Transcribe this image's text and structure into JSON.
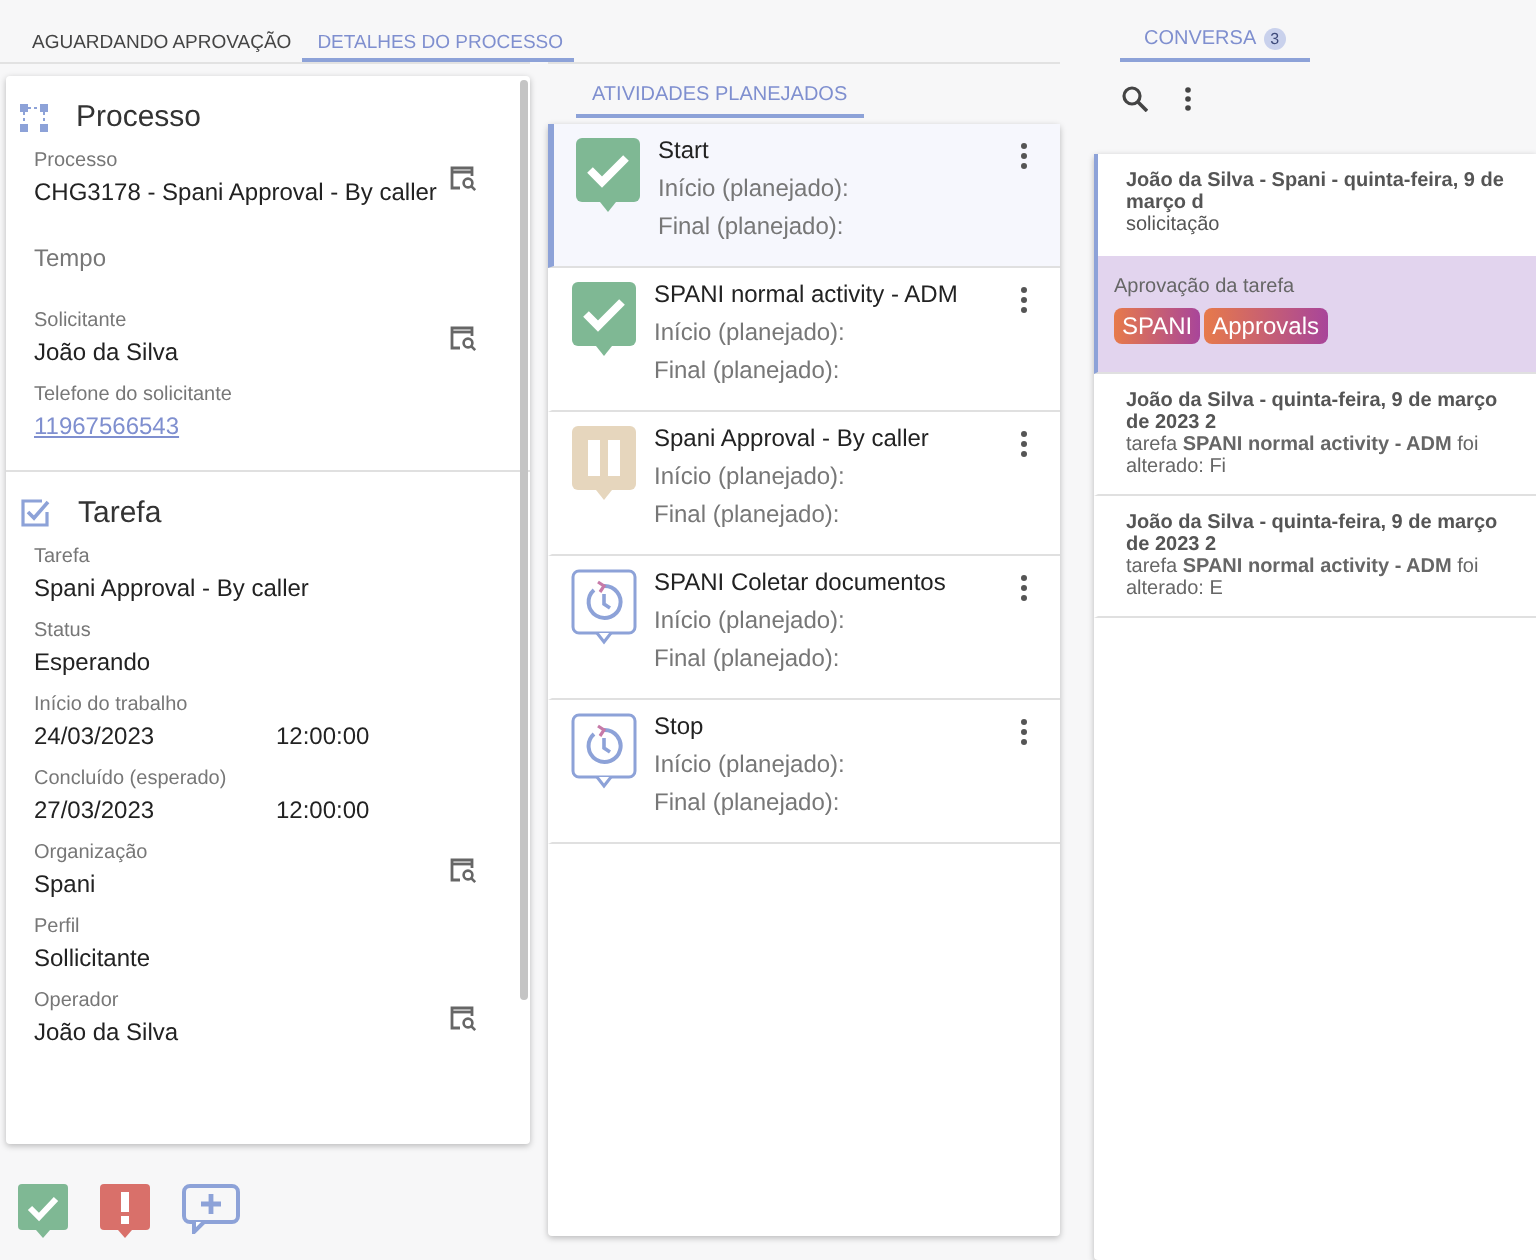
{
  "left_tabs": [
    {
      "label": "AGUARDANDO APROVAÇÃO",
      "selected": false
    },
    {
      "label": "DETALHES DO PROCESSO",
      "selected": true
    }
  ],
  "process": {
    "title": "Processo",
    "fields": [
      {
        "kind": "lookup",
        "label": "Processo",
        "value": "CHG3178 - Spani Approval - By caller"
      },
      {
        "kind": "empty",
        "label": "Tempo"
      },
      {
        "kind": "lookup",
        "label": "Solicitante",
        "value": "João  da Silva"
      },
      {
        "kind": "link",
        "label": "Telefone do solicitante",
        "value": "11967566543"
      }
    ]
  },
  "task": {
    "title": "Tarefa",
    "fields": [
      {
        "kind": "plain",
        "label": "Tarefa",
        "value": "Spani Approval - By caller"
      },
      {
        "kind": "plain",
        "label": "Status",
        "value": "Esperando"
      },
      {
        "kind": "datetime",
        "label": "Início do trabalho",
        "value": "24/03/2023",
        "time": "12:00:00"
      },
      {
        "kind": "datetime",
        "label": "Concluído (esperado)",
        "value": "27/03/2023",
        "time": "12:00:00"
      },
      {
        "kind": "lookup",
        "label": "Organização",
        "value": "Spani"
      },
      {
        "kind": "plain",
        "label": "Perfil",
        "value": "Sollicitante"
      },
      {
        "kind": "lookup",
        "label": "Operador",
        "value": "João  da Silva"
      }
    ]
  },
  "activities_tab": {
    "label": "ATIVIDADES PLANEJADOS",
    "selected": true
  },
  "activities": [
    {
      "kind": "done",
      "title": "Start",
      "start": "Início (planejado):",
      "end": "Final (planejado):",
      "selected": true
    },
    {
      "kind": "done",
      "title": "SPANI normal activity - ADM",
      "start": "Início (planejado):",
      "end": "Final (planejado):",
      "selected": false
    },
    {
      "kind": "paused",
      "title": "Spani Approval - By caller",
      "start": "Início (planejado):",
      "end": "Final (planejado):",
      "selected": false
    },
    {
      "kind": "scheduled",
      "title": "SPANI Coletar documentos",
      "start": "Início (planejado):",
      "end": "Final (planejado):",
      "selected": false
    },
    {
      "kind": "scheduled",
      "title": "Stop",
      "start": "Início (planejado):",
      "end": "Final (planejado):",
      "selected": false
    }
  ],
  "conversation_tab": {
    "label": "CONVERSA",
    "badge": "3",
    "selected": true
  },
  "messages": [
    {
      "kind": "request",
      "header": "João da Silva - Spani - quinta-feira, 9 de março d",
      "subtitle": "solicitação",
      "note": "Aprovação da tarefa",
      "tags": [
        "SPANI",
        "Approvals"
      ],
      "selected": true
    },
    {
      "kind": "update",
      "header": "João da Silva - quinta-feira, 9 de março de 2023 2",
      "body": "tarefa **SPANI normal activity - ADM** foi alterado: Fi",
      "selected": false
    },
    {
      "kind": "update",
      "header": "João da Silva - quinta-feira, 9 de março de 2023 2",
      "body": "tarefa **SPANI normal activity - ADM** foi alterado: E",
      "selected": false
    }
  ]
}
